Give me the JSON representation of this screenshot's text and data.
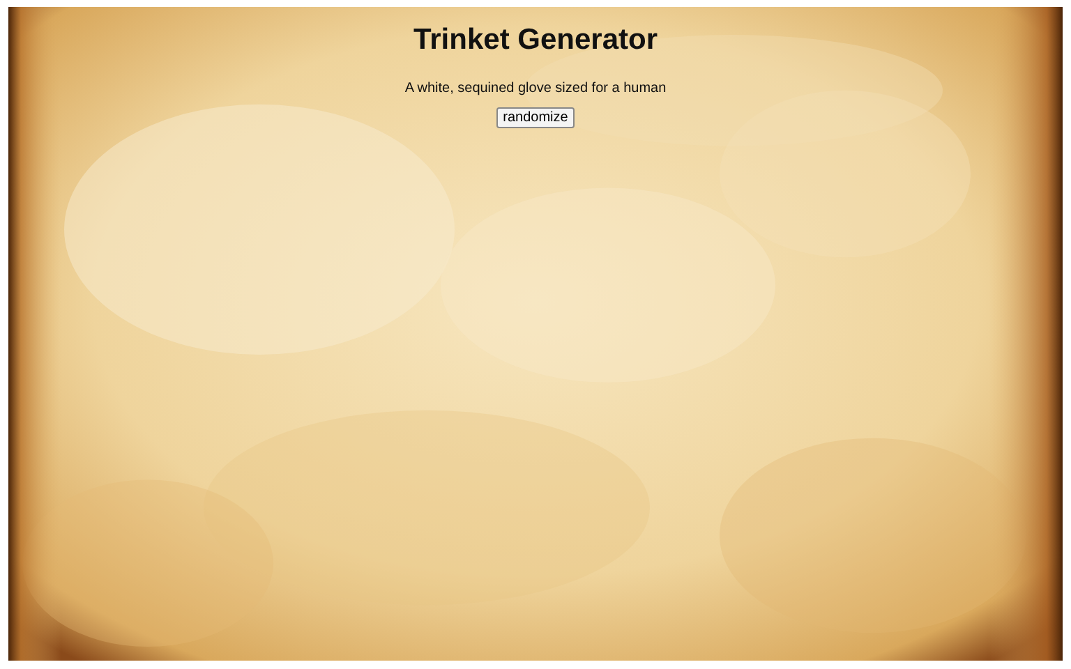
{
  "title": "Trinket Generator",
  "trinket": "A white, sequined glove sized for a human",
  "button": "randomize"
}
